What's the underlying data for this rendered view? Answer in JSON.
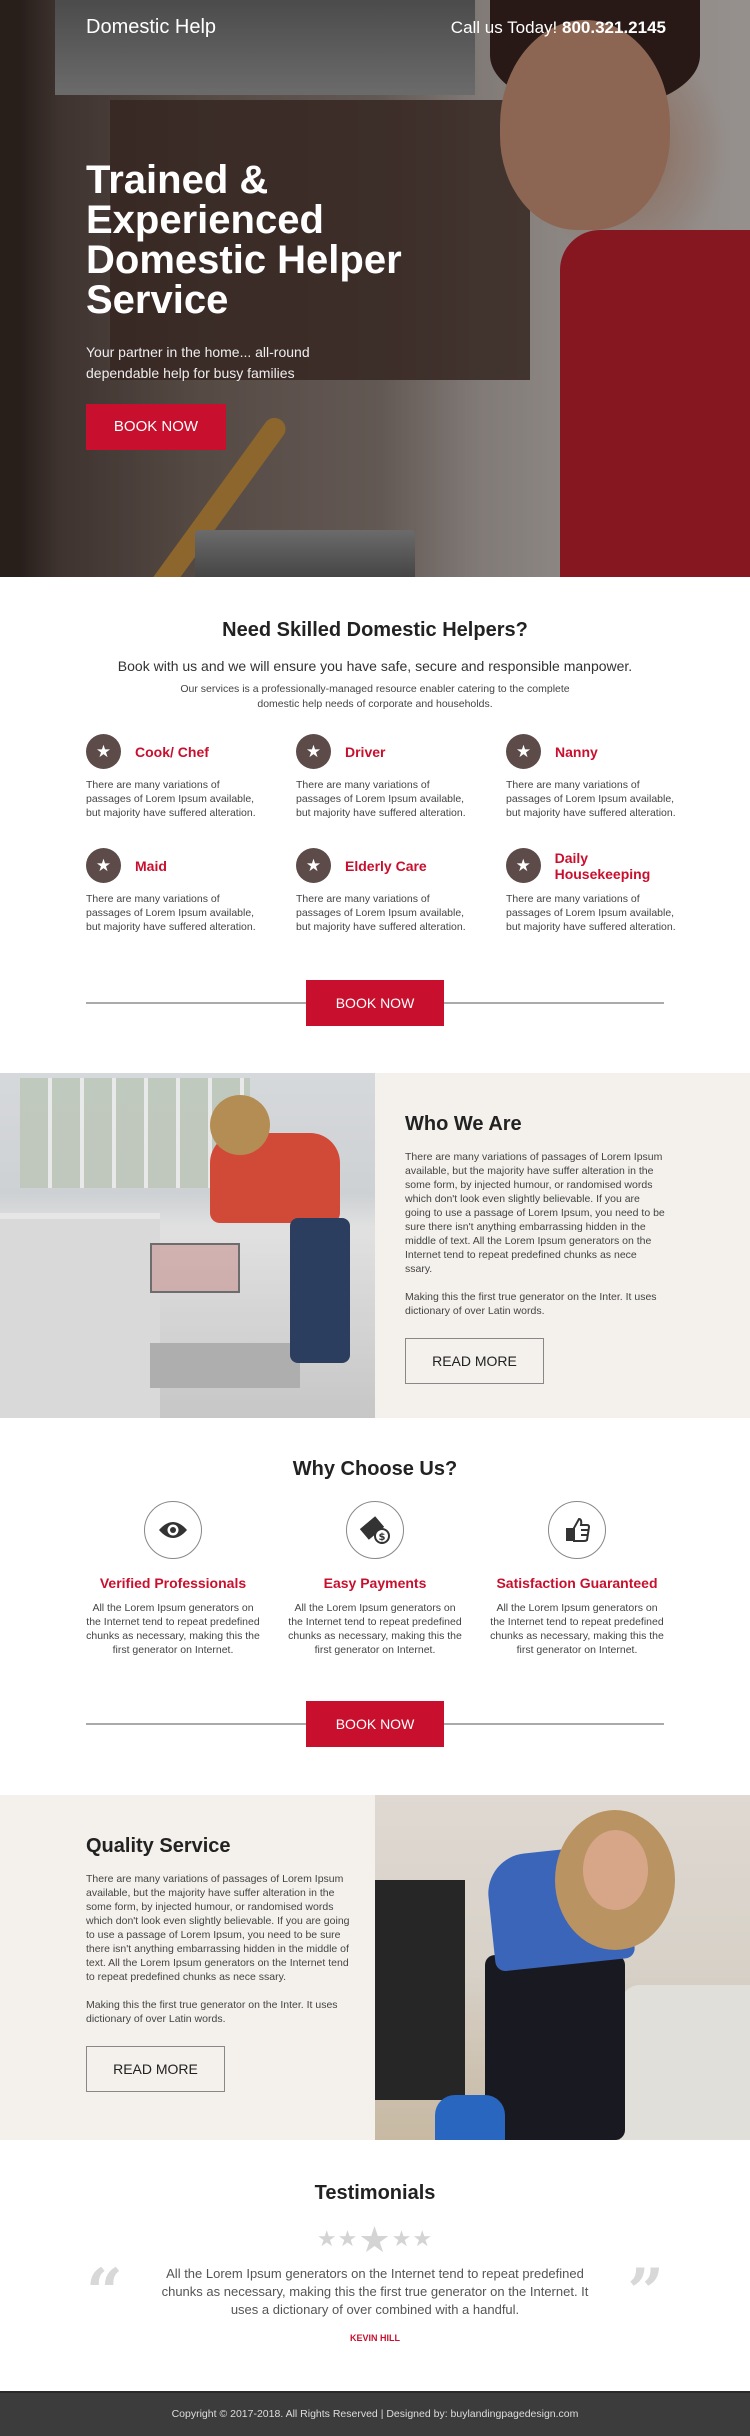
{
  "header": {
    "brand": "Domestic Help",
    "call_label": "Call us Today!",
    "phone": "800.321.2145"
  },
  "hero": {
    "title": "Trained & Experienced Domestic Helper Service",
    "subtitle": "Your partner in the home... all-round dependable help for busy families",
    "cta_label": "BOOK NOW"
  },
  "services": {
    "title": "Need Skilled Domestic Helpers?",
    "lead": "Book with us and we will ensure you have safe, secure and responsible manpower.",
    "lead_small": "Our services is a  professionally-managed resource enabler catering to the complete domestic help needs of corporate and households.",
    "items": [
      {
        "icon": "star-icon",
        "title": "Cook/ Chef",
        "desc": "There are many variations of passages of Lorem Ipsum available, but majority have suffered alteration."
      },
      {
        "icon": "star-icon",
        "title": "Driver",
        "desc": "There are many variations of passages of Lorem Ipsum available, but majority have suffered alteration."
      },
      {
        "icon": "star-icon",
        "title": "Nanny",
        "desc": "There are many variations of passages of Lorem Ipsum available, but majority have suffered alteration."
      },
      {
        "icon": "star-icon",
        "title": "Maid",
        "desc": "There are many variations of passages of Lorem Ipsum available, but majority have suffered alteration."
      },
      {
        "icon": "star-icon",
        "title": "Elderly Care",
        "desc": "There are many variations of passages of Lorem Ipsum available, but majority have suffered alteration."
      },
      {
        "icon": "star-icon",
        "title": "Daily Housekeeping",
        "desc": "There are many variations of passages of Lorem Ipsum available, but majority have suffered alteration."
      }
    ],
    "cta_label": "BOOK NOW"
  },
  "who": {
    "title": "Who We Are",
    "para1": "There are many variations of passages of Lorem Ipsum available, but the majority have suffer alteration in the some form, by injected humour, or randomised words which don't look even slightly believable. If you are going to use a passage of Lorem Ipsum, you need to be sure there isn't anything embarrassing hidden in the middle of text. All the Lorem Ipsum generators on the Internet tend to repeat predefined chunks as nece ssary.",
    "para2": "Making this the first true generator on the Inter. It uses dictionary of over Latin words.",
    "button": "READ MORE"
  },
  "why": {
    "title": "Why Choose Us?",
    "items": [
      {
        "icon": "eye-icon",
        "title": "Verified Professionals",
        "desc": "All the Lorem Ipsum generators on the Internet tend to repeat predefined chunks as necessary, making this the first generator on Internet."
      },
      {
        "icon": "money-icon",
        "title": "Easy Payments",
        "desc": "All the Lorem Ipsum generators on the Internet tend to repeat predefined chunks as necessary, making this the first generator on Internet."
      },
      {
        "icon": "thumbs-up-icon",
        "title": "Satisfaction Guaranteed",
        "desc": "All the Lorem Ipsum generators on the Internet tend to repeat predefined chunks as necessary, making this the first generator on Internet."
      }
    ],
    "cta_label": "BOOK NOW"
  },
  "quality": {
    "title": "Quality Service",
    "para1": "There are many variations of passages of Lorem Ipsum available, but the majority have suffer alteration in the some form, by injected humour, or randomised words which don't look even slightly believable. If you are going to use a passage of Lorem Ipsum, you need to be sure there isn't anything embarrassing hidden in the middle of text. All the Lorem Ipsum generators on the Internet tend to repeat predefined chunks as nece ssary.",
    "para2": "Making this the first true generator on the Inter. It uses dictionary of over Latin words.",
    "button": "READ MORE"
  },
  "testimonials": {
    "title": "Testimonials",
    "rating_stars": 5,
    "quote": "All the Lorem Ipsum generators on the Internet tend to repeat predefined chunks as necessary, making this the first true generator on the Internet. It uses a dictionary of over combined with a handful.",
    "author": "KEVIN HILL"
  },
  "footer": {
    "text": "Copyright © 2017-2018. All Rights Reserved  |  Designed by: buylandingpagedesign.com"
  },
  "colors": {
    "accent": "#c8102e",
    "icon_bg": "#5c4b48",
    "panel_bg": "#f4f1ec",
    "footer_bg": "#3c3c3c"
  }
}
